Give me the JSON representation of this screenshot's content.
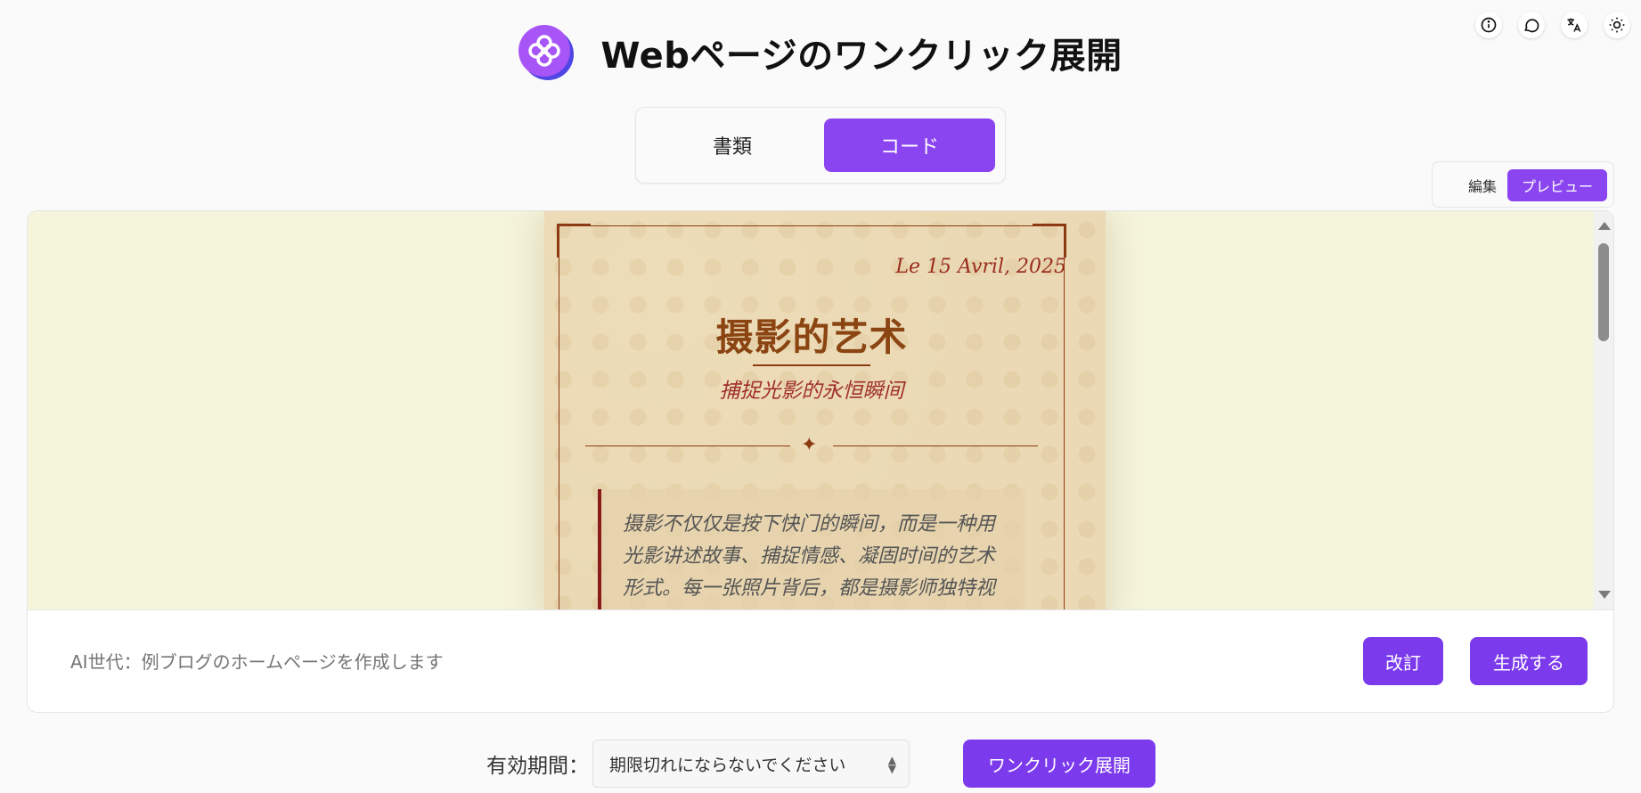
{
  "header": {
    "title": "Webページのワンクリック展開"
  },
  "top_icons": [
    "info-icon",
    "chat-icon",
    "translate-icon",
    "sun-icon"
  ],
  "mode_tabs": {
    "document": "書類",
    "code": "コード",
    "active": "code"
  },
  "view_tabs": {
    "edit": "編集",
    "preview": "プレビュー",
    "active": "preview"
  },
  "preview": {
    "date": "Le 15 Avril, 2025",
    "title": "摄影的艺术",
    "subtitle": "捕捉光影的永恒瞬间",
    "divider_symbol": "✦",
    "quote_lines": [
      "摄影不仅仅是按下快门的瞬间，而是一种用",
      "光影讲述故事、捕捉情感、凝固时间的艺术",
      "形式。每一张照片背后，都是摄影师独特视"
    ]
  },
  "prompt": {
    "placeholder": "AI世代：例ブログのホームページを作成します",
    "revise_label": "改訂",
    "generate_label": "生成する"
  },
  "footer": {
    "expiry_label": "有効期間：",
    "expiry_value": "期限切れにならないでください",
    "deploy_label": "ワンクリック展開"
  },
  "colors": {
    "accent": "#8b45f0",
    "button": "#7c3aed",
    "preview_bg": "#f5f5dc",
    "paper_title": "#8b4513",
    "paper_accent": "#9b2d1e"
  }
}
